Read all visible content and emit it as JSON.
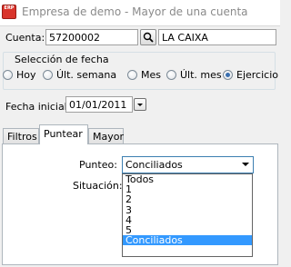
{
  "window": {
    "icon_text": "ERP",
    "title": "Empresa de demo - Mayor de una cuenta"
  },
  "cuenta": {
    "label": "Cuenta:",
    "code": "57200002",
    "name": "LA CAIXA"
  },
  "fecha_group": {
    "title": "Selección de fecha",
    "options": [
      "Hoy",
      "Últ. semana",
      "Mes",
      "Últ. mes",
      "Ejercicio"
    ],
    "selected": "Ejercicio"
  },
  "fecha_inicial": {
    "label": "Fecha inicial:",
    "value": "01/01/2011"
  },
  "tabs": [
    "Filtros",
    "Puntear",
    "Mayor"
  ],
  "active_tab": "Puntear",
  "punteo": {
    "label": "Punteo:",
    "selected": "Conciliados",
    "options": [
      "Todos",
      "1",
      "2",
      "3",
      "4",
      "5",
      "Conciliados"
    ]
  },
  "situacion": {
    "label": "Situación:"
  },
  "colors": {
    "selection": "#3399ff",
    "combo_border": "#3c7fb1",
    "icon_red": "#d9342b"
  }
}
